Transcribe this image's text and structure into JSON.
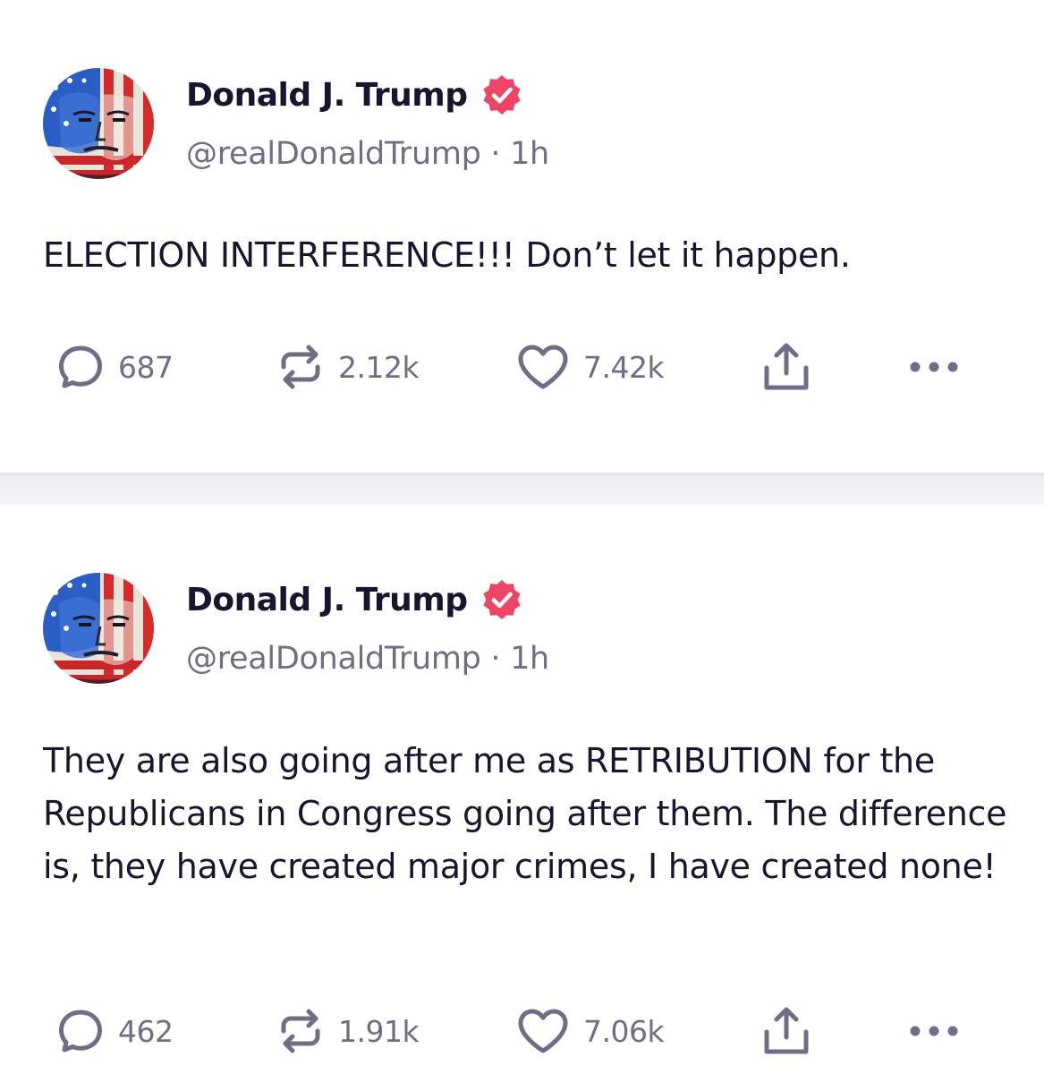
{
  "colors": {
    "verified_badge": "#ee4466",
    "text_primary": "#17162e",
    "text_secondary": "#6f6e84"
  },
  "posts": [
    {
      "author": {
        "display_name": "Donald J. Trump",
        "handle": "@realDonaldTrump",
        "verified": true
      },
      "time_ago": "1h",
      "separator": "·",
      "text": "ELECTION INTERFERENCE!!! Don’t let it happen.",
      "stats": {
        "replies": "687",
        "retruths": "2.12k",
        "likes": "7.42k"
      }
    },
    {
      "author": {
        "display_name": "Donald J. Trump",
        "handle": "@realDonaldTrump",
        "verified": true
      },
      "time_ago": "1h",
      "separator": "·",
      "text": "They are also going after me as RETRIBUTION for the Republicans in Congress going after them. The difference is, they have created major crimes, I have created none!",
      "stats": {
        "replies": "462",
        "retruths": "1.91k",
        "likes": "7.06k"
      }
    }
  ],
  "icons": {
    "reply": "speech-bubble-icon",
    "retruth": "repost-arrows-icon",
    "like": "heart-icon",
    "share": "share-upload-icon",
    "more": "ellipsis-icon",
    "verified": "verified-badge-icon"
  }
}
